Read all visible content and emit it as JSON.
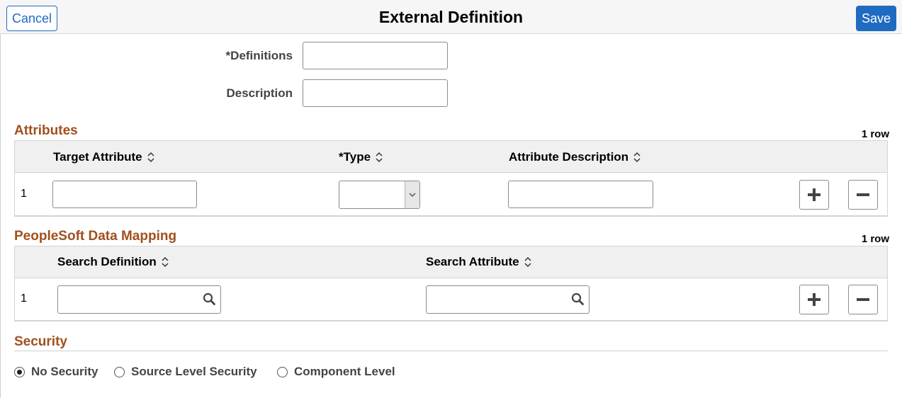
{
  "header": {
    "title": "External Definition",
    "cancel_label": "Cancel",
    "save_label": "Save"
  },
  "form": {
    "definitions_label": "*Definitions",
    "definitions_value": "",
    "description_label": "Description",
    "description_value": ""
  },
  "attributes": {
    "title": "Attributes",
    "row_count": "1 row",
    "columns": [
      "Target Attribute",
      "*Type",
      "Attribute Description"
    ],
    "rows": [
      {
        "num": "1",
        "target_attribute": "",
        "type": "",
        "attribute_description": ""
      }
    ]
  },
  "mapping": {
    "title": "PeopleSoft Data Mapping",
    "row_count": "1 row",
    "columns": [
      "Search Definition",
      "Search Attribute"
    ],
    "rows": [
      {
        "num": "1",
        "search_definition": "",
        "search_attribute": ""
      }
    ]
  },
  "security": {
    "title": "Security",
    "options": [
      {
        "label": "No Security",
        "selected": true
      },
      {
        "label": "Source Level Security",
        "selected": false
      },
      {
        "label": "Component Level",
        "selected": false
      }
    ]
  },
  "colors": {
    "accent": "#1f6bc1",
    "section_title": "#a0501e"
  },
  "icons": {
    "sort": "sort-updown-icon",
    "add": "plus-icon",
    "delete": "minus-icon",
    "lookup": "search-icon",
    "dropdown": "chevron-down-icon"
  }
}
